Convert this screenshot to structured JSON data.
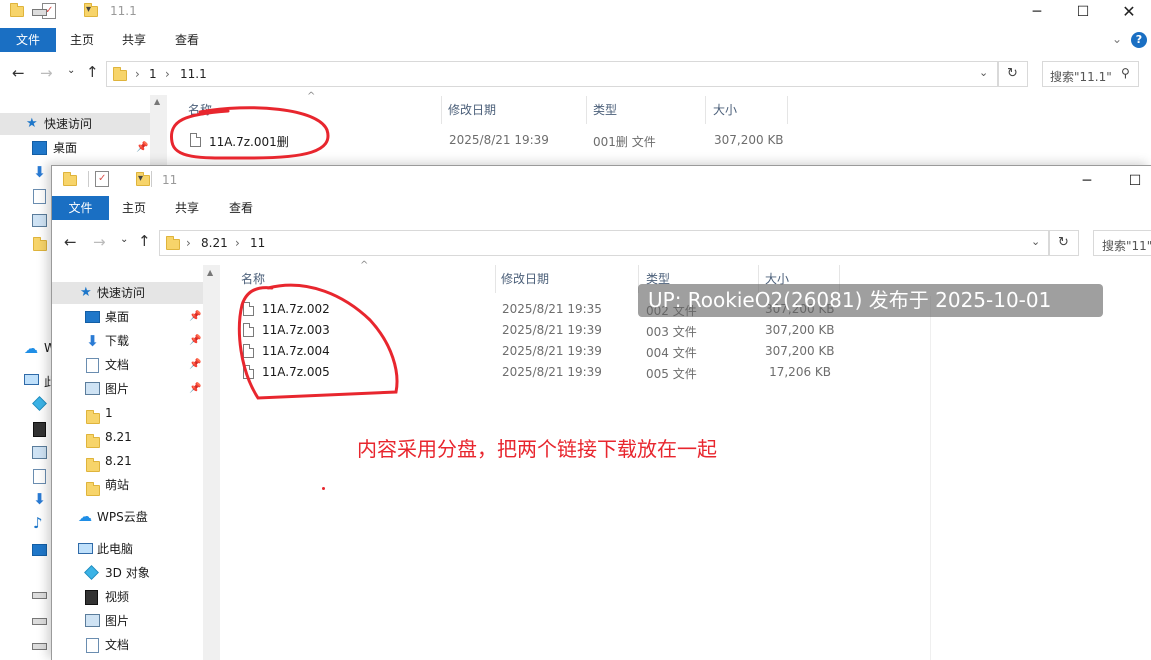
{
  "back_window": {
    "title": "11.1",
    "ribbon_tabs": [
      "文件",
      "主页",
      "共享",
      "查看"
    ],
    "path": [
      "1",
      "11.1"
    ],
    "search_placeholder": "搜索\"11.1\"",
    "columns": [
      "名称",
      "修改日期",
      "类型",
      "大小"
    ],
    "files": [
      {
        "name": "11A.7z.001删",
        "date": "2025/8/21 19:39",
        "type": "001删 文件",
        "size": "307,200 KB"
      }
    ],
    "sidebar": {
      "quick_access": "快速访问",
      "items": [
        "桌面",
        "W",
        "此"
      ]
    }
  },
  "front_window": {
    "title": "11",
    "ribbon_tabs": [
      "文件",
      "主页",
      "共享",
      "查看"
    ],
    "path": [
      "8.21",
      "11"
    ],
    "search_placeholder": "搜索\"11\"",
    "columns": [
      "名称",
      "修改日期",
      "类型",
      "大小"
    ],
    "files": [
      {
        "name": "11A.7z.002",
        "date": "2025/8/21 19:35",
        "type": "002 文件",
        "size": "307,200 KB"
      },
      {
        "name": "11A.7z.003",
        "date": "2025/8/21 19:39",
        "type": "003 文件",
        "size": "307,200 KB"
      },
      {
        "name": "11A.7z.004",
        "date": "2025/8/21 19:39",
        "type": "004 文件",
        "size": "307,200 KB"
      },
      {
        "name": "11A.7z.005",
        "date": "2025/8/21 19:39",
        "type": "005 文件",
        "size": "17,206 KB"
      }
    ],
    "sidebar": {
      "quick_access": "快速访问",
      "quick_items": [
        {
          "label": "桌面",
          "icon": "desktop-icon",
          "pinned": true
        },
        {
          "label": "下载",
          "icon": "download-icon",
          "pinned": true
        },
        {
          "label": "文档",
          "icon": "document-icon",
          "pinned": true
        },
        {
          "label": "图片",
          "icon": "picture-icon",
          "pinned": true
        },
        {
          "label": "1",
          "icon": "folder-icon",
          "pinned": false
        },
        {
          "label": "8.21",
          "icon": "folder-icon",
          "pinned": false
        },
        {
          "label": "8.21",
          "icon": "folder-icon",
          "pinned": false
        },
        {
          "label": "萌站",
          "icon": "folder-icon",
          "pinned": false
        }
      ],
      "wps": "WPS云盘",
      "this_pc": "此电脑",
      "pc_items": [
        {
          "label": "3D 对象",
          "icon": "3d-objects-icon"
        },
        {
          "label": "视频",
          "icon": "video-icon"
        },
        {
          "label": "图片",
          "icon": "picture-icon"
        },
        {
          "label": "文档",
          "icon": "document-icon"
        }
      ]
    }
  },
  "watermark": "UP: RookieO2(26081) 发布于 2025-10-01",
  "annotation": "内容采用分盘，把两个链接下载放在一起",
  "colors": {
    "accent": "#1a6fc3",
    "annotation": "#e8262e",
    "selected": "#e5e5e5"
  }
}
